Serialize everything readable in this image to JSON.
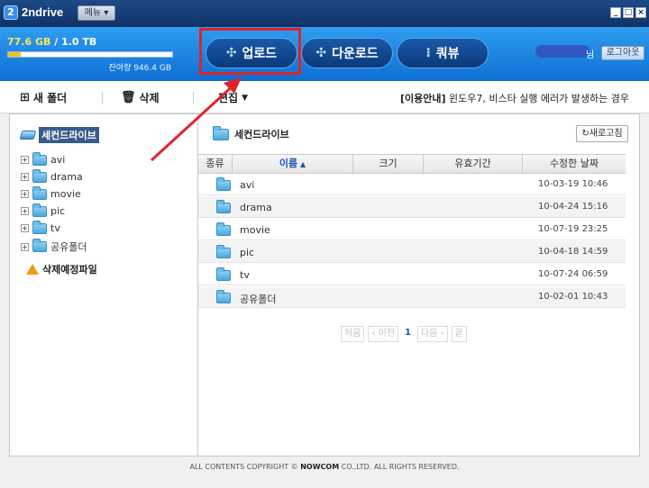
{
  "titlebar": {
    "app_name": "2ndrive",
    "logo_letter": "2",
    "menu_label": "메뉴 ▾",
    "window_buttons": [
      "_",
      "□",
      "×"
    ]
  },
  "header": {
    "used": "77.6 GB",
    "separator": " / ",
    "total": "1.0 TB",
    "used_fraction": 0.076,
    "remaining": "잔여량 946.4 GB",
    "buttons": {
      "upload": "업로드",
      "download": "다운로드",
      "queue": "쿼뷰"
    },
    "user_suffix": "님",
    "logout": "로그아웃",
    "colors": {
      "accent": "#1a7fe0",
      "highlight": "#e0232b",
      "bar_fill": "#f2c11c"
    }
  },
  "toolbar": {
    "new_folder": "새 폴더",
    "delete": "삭제",
    "edit": "편집",
    "notice_label": "[이용안내]",
    "notice_text": " 윈도우7, 비스타 실행 에러가 발생하는 경우"
  },
  "tree": {
    "root": "세컨드라이브",
    "items": [
      "avi",
      "drama",
      "movie",
      "pic",
      "tv",
      "공유폴더"
    ],
    "trash": "삭제예정파일"
  },
  "panel": {
    "title": "세컨드라이브",
    "refresh": "새로고침",
    "columns": {
      "type": "종류",
      "name": "이름",
      "size": "크기",
      "expiry": "유효기간",
      "modified": "수정한 날짜"
    },
    "rows": [
      {
        "name": "avi",
        "date": "10-03-19 10:46"
      },
      {
        "name": "drama",
        "date": "10-04-24 15:16"
      },
      {
        "name": "movie",
        "date": "10-07-19 23:25"
      },
      {
        "name": "pic",
        "date": "10-04-18 14:59"
      },
      {
        "name": "tv",
        "date": "10-07-24 06:59"
      },
      {
        "name": "공유폴더",
        "date": "10-02-01 10:43"
      }
    ],
    "pager": {
      "first": "처음",
      "prev": "‹ 이전",
      "current": "1",
      "next": "다음 ›",
      "last": "끝"
    }
  },
  "footer": {
    "prefix": "ALL CONTENTS COPYRIGHT © ",
    "brand": "NOWCOM",
    "suffix": " CO.,LTD. ALL RIGHTS RESERVED."
  }
}
